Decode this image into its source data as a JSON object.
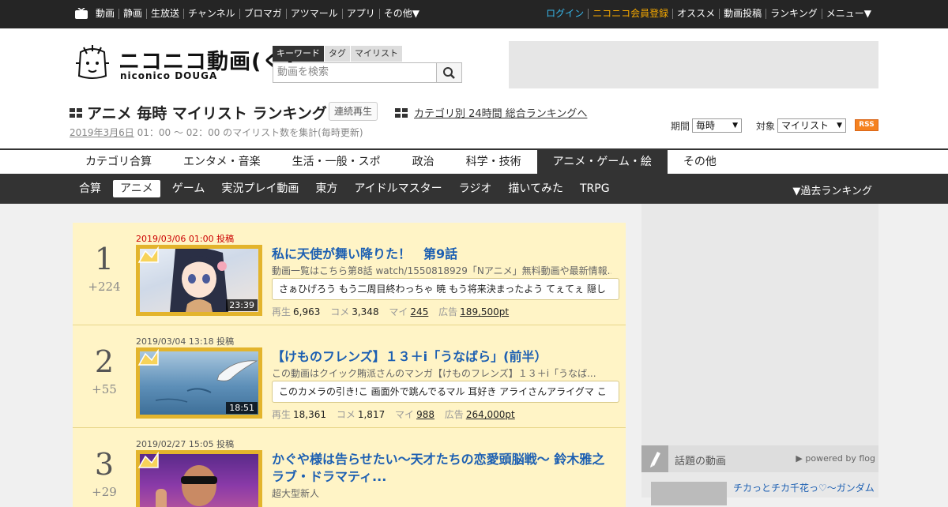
{
  "topbar": {
    "left_nav": [
      "動画",
      "静画",
      "生放送",
      "チャンネル",
      "ブロマガ",
      "アツマール",
      "アプリ",
      "その他▼"
    ],
    "right_nav": {
      "login": "ログイン",
      "register": "ニコニコ会員登録",
      "items": [
        "オススメ",
        "動画投稿",
        "ランキング",
        "メニュー▼"
      ]
    }
  },
  "logo": {
    "title": "ニコニコ動画(く)",
    "subtitle": "niconico DOUGA"
  },
  "search": {
    "tabs": [
      "キーワード",
      "タグ",
      "マイリスト"
    ],
    "placeholder": "動画を検索"
  },
  "page": {
    "title": "アニメ 毎時 マイリスト ランキング",
    "continuous_play": "連続再生",
    "category_link": "カテゴリ別 24時間 総合ランキングへ",
    "date": "2019年3月6日",
    "period_text": " 01：00 ～ 02：00 のマイリスト数を集計(毎時更新)",
    "period_label": "期間",
    "period_value": "毎時",
    "target_label": "対象",
    "target_value": "マイリスト",
    "rss": "RSS"
  },
  "genre_tabs": [
    "カテゴリ合算",
    "エンタメ・音楽",
    "生活・一般・スポ",
    "政治",
    "科学・技術",
    "アニメ・ゲーム・絵",
    "その他"
  ],
  "sub_nav": {
    "items": [
      "合算",
      "アニメ",
      "ゲーム",
      "実況プレイ動画",
      "東方",
      "アイドルマスター",
      "ラジオ",
      "描いてみた",
      "TRPG"
    ],
    "past": "▼過去ランキング"
  },
  "ranking": [
    {
      "rank": "1",
      "delta": "+224",
      "posted": "2019/03/06 01:00 投稿",
      "title": "私に天使が舞い降りた！　第9話",
      "desc": "動画一覧はこちら第8話 watch/1550818929「Nアニメ」無料動画や最新情報...",
      "comment": "さぁひげろう もう二周目終わっちゃ 暁 もう将来決まったよう てぇてぇ 隠し",
      "duration": "23:39",
      "views": "6,963",
      "comments": "3,348",
      "mylists": "245",
      "ad": "189,500pt"
    },
    {
      "rank": "2",
      "delta": "+55",
      "posted": "2019/03/04 13:18 投稿",
      "title": "【けものフレンズ】１３＋i「うなばら」(前半）",
      "desc": "この動画はクイック賄派さんのマンガ【けものフレンズ】１３＋i「うなば...",
      "comment": "このカメラの引き!こ 画面外で跳んでるマル 耳好き アライさんアライグマ こ",
      "duration": "18:51",
      "views": "18,361",
      "comments": "1,817",
      "mylists": "988",
      "ad": "264,000pt"
    },
    {
      "rank": "3",
      "delta": "+29",
      "posted": "2019/02/27 15:05 投稿",
      "title": "かぐや様は告らせたい～天才たちの恋愛頭脳戦～ 鈴木雅之 ラブ・ドラマティ...",
      "desc": "超大型新人",
      "comment": "",
      "duration": "",
      "views": "",
      "comments": "",
      "mylists": "",
      "ad": ""
    }
  ],
  "stat_labels": {
    "views": "再生",
    "comments": "コメ",
    "mylists": "マイ",
    "ad": "広告"
  },
  "side": {
    "widget_title": "話題の動画",
    "powered": "▶ powered by flog",
    "topic_title": "チカっとチカ千花っ♡～ガンダム"
  }
}
